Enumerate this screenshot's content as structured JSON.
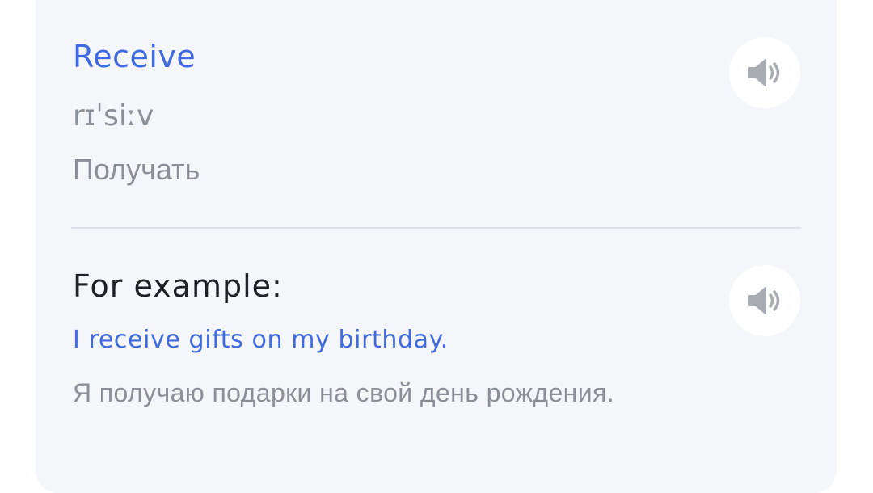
{
  "word_card": {
    "word": "Receive",
    "transcription": "rɪˈsiːv",
    "translation": "Получать",
    "word_sound_icon": "speaker-icon"
  },
  "example": {
    "heading": "For example:",
    "sentence": "I receive gifts on my birthday.",
    "translation": "Я получаю подарки на свой день рождения.",
    "sound_icon": "speaker-icon"
  },
  "colors": {
    "accent": "#3f6ae0",
    "card_background": "#f5f6fa",
    "muted_text": "#8b8f98",
    "heading_text": "#1f2126",
    "icon": "#a9acb3"
  }
}
